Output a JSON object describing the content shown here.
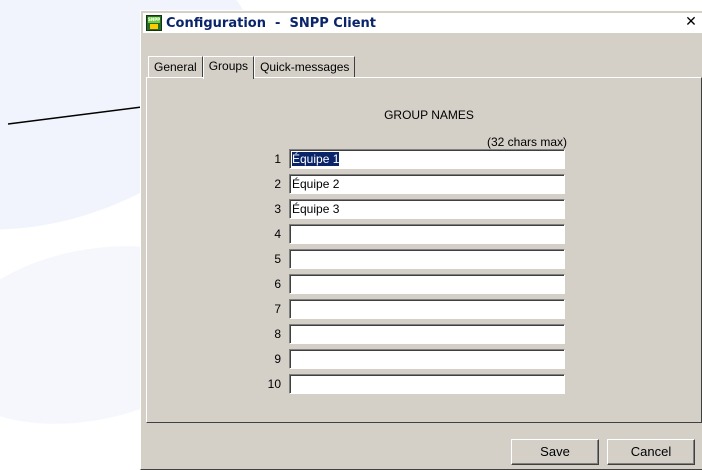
{
  "window": {
    "title": "Configuration  -  SNPP Client",
    "close_glyph": "✕",
    "app_icon_label": "SNPP"
  },
  "tabs": [
    {
      "label": "General",
      "active": false
    },
    {
      "label": "Groups",
      "active": true
    },
    {
      "label": "Quick-messages",
      "active": false
    }
  ],
  "groups": {
    "header": "GROUP NAMES",
    "limit_note": "(32 chars max)",
    "rows": [
      {
        "num": "1",
        "value": "Équipe 1"
      },
      {
        "num": "2",
        "value": "Équipe 2"
      },
      {
        "num": "3",
        "value": "Équipe 3"
      },
      {
        "num": "4",
        "value": ""
      },
      {
        "num": "5",
        "value": ""
      },
      {
        "num": "6",
        "value": ""
      },
      {
        "num": "7",
        "value": ""
      },
      {
        "num": "8",
        "value": ""
      },
      {
        "num": "9",
        "value": ""
      },
      {
        "num": "10",
        "value": ""
      }
    ]
  },
  "buttons": {
    "save": "Save",
    "cancel": "Cancel"
  }
}
